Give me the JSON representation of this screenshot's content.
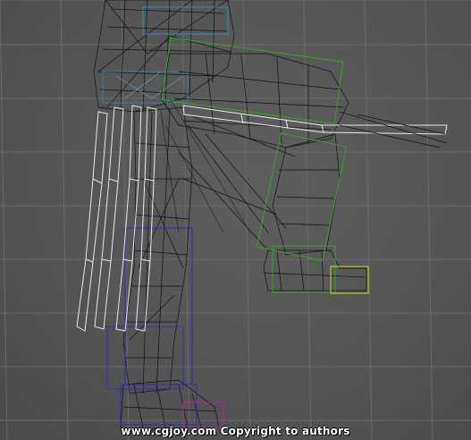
{
  "viewport": {
    "colors": {
      "background": "#585858",
      "grid": "#6a6a6a",
      "mesh": "#111111",
      "bones": "#e8e8f0",
      "left_leg_box": "#2a2ab8",
      "right_leg_box": "#3da12b",
      "foot_box": "#b7c72a",
      "belt_box": "#2f8fb0"
    }
  },
  "watermark": {
    "text": "www.cgjoy.com Copyright to authors"
  }
}
